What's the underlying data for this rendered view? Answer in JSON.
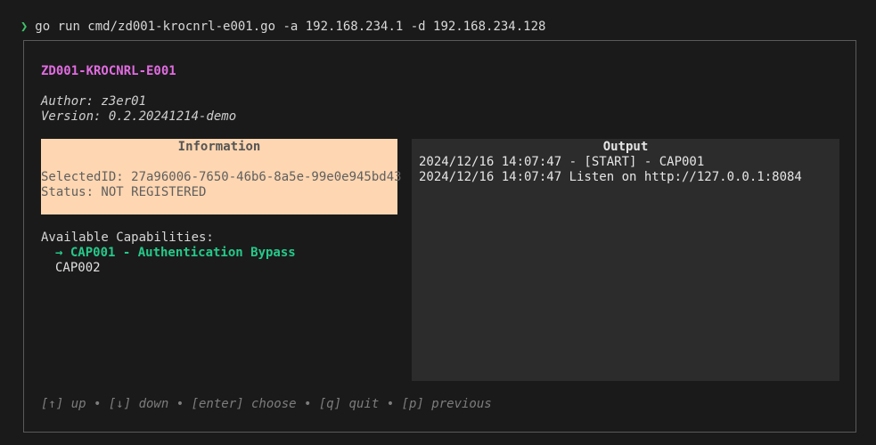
{
  "terminal": {
    "prompt_symbol": "❯",
    "command": "go run cmd/zd001-krocnrl-e001.go -a 192.168.234.1 -d 192.168.234.128"
  },
  "app": {
    "title": "ZD001-KROCNRL-E001",
    "author": "Author: z3er01",
    "version": "Version: 0.2.20241214-demo"
  },
  "information": {
    "title": "Information",
    "selected_id": "SelectedID: 27a96006-7650-46b6-8a5e-99e0e945bd43",
    "status": "Status: NOT REGISTERED"
  },
  "capabilities": {
    "header": "Available Capabilities:",
    "items": [
      {
        "label": "→ CAP001 - Authentication Bypass",
        "selected": true
      },
      {
        "label": "CAP002",
        "selected": false
      }
    ]
  },
  "output": {
    "title": "Output",
    "lines": [
      "2024/12/16 14:07:47 - [START] - CAP001",
      "2024/12/16 14:07:47 Listen on http://127.0.0.1:8084"
    ]
  },
  "help": {
    "text": "[↑] up • [↓] down • [enter] choose • [q] quit • [p] previous"
  },
  "colors": {
    "background": "#1a1a1a",
    "prompt": "#3fc46a",
    "title": "#e06ce0",
    "info_bg": "#fed6b1",
    "selected": "#25c98a",
    "output_bg": "#2c2c2c"
  }
}
